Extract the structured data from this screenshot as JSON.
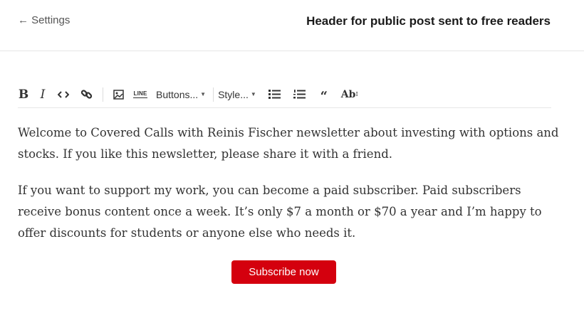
{
  "header": {
    "back_label": "← Settings",
    "title": "Header for public post sent to free readers"
  },
  "toolbar": {
    "bold_label": "B",
    "italic_label": "I",
    "code_icon": "code-icon",
    "link_icon": "link-icon",
    "image_icon": "image-icon",
    "line_label": "LINE",
    "buttons_label": "Buttons...",
    "style_label": "Style...",
    "bullet_icon": "bulleted-list-icon",
    "numbered_icon": "numbered-list-icon",
    "quote_label": "“",
    "ab_label": "Ab",
    "ab_sup": "I"
  },
  "editor": {
    "paragraphs": [
      "Welcome to Covered Calls with Reinis Fischer newsletter about investing with options and stocks.  If you like this newsletter, please share it with a friend.",
      "If you want to support my work, you can become a paid subscriber.  Paid subscribers receive bonus content once a week.  It’s only $7 a month or $70 a year and I’m happy to offer discounts for students or anyone else who needs it."
    ],
    "subscribe_label": "Subscribe now"
  },
  "colors": {
    "accent": "#d4000e",
    "text": "#333333",
    "divider": "#e6e6e6"
  }
}
